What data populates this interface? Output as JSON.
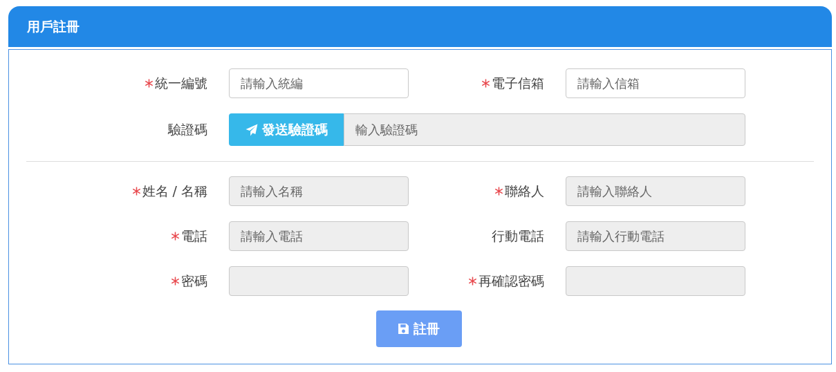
{
  "panel": {
    "title": "用戶註冊"
  },
  "sections": [
    {
      "fields": [
        {
          "kind": "input",
          "label": "統一編號",
          "required": true,
          "placeholder": "請輸入統編",
          "disabled": false
        },
        {
          "kind": "input",
          "label": "電子信箱",
          "required": true,
          "placeholder": "請輸入信箱",
          "disabled": false
        },
        {
          "kind": "verify",
          "label": "驗證碼",
          "required": false,
          "button": "發送驗證碼",
          "placeholder": "輸入驗證碼",
          "disabled": true
        }
      ]
    },
    {
      "fields": [
        {
          "kind": "input",
          "label": "姓名 / 名稱",
          "required": true,
          "placeholder": "請輸入名稱",
          "disabled": true
        },
        {
          "kind": "input",
          "label": "聯絡人",
          "required": true,
          "placeholder": "請輸入聯絡人",
          "disabled": true
        },
        {
          "kind": "input",
          "label": "電話",
          "required": true,
          "placeholder": "請輸入電話",
          "disabled": true
        },
        {
          "kind": "input",
          "label": "行動電話",
          "required": false,
          "placeholder": "請輸入行動電話",
          "disabled": true
        },
        {
          "kind": "input",
          "label": "密碼",
          "required": true,
          "disabled": true
        },
        {
          "kind": "input",
          "label": "再確認密碼",
          "required": true,
          "disabled": true
        }
      ]
    }
  ],
  "submit": {
    "label": "註冊",
    "disabled": true
  }
}
